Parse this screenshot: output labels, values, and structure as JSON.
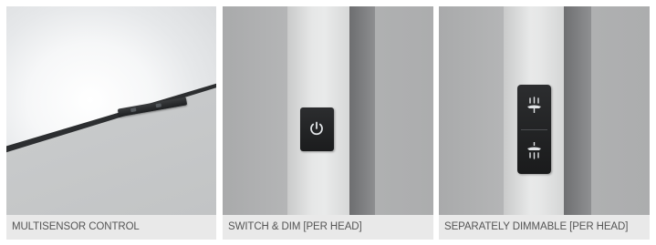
{
  "panels": [
    {
      "caption": "MULTISENSOR CONTROL"
    },
    {
      "caption": "SWITCH & DIM [PER HEAD]"
    },
    {
      "caption": "SEPARATELY DIMMABLE [PER HEAD]"
    }
  ],
  "icons": {
    "panel_2": "power-icon",
    "panel_3_top": "uplight-icon",
    "panel_3_bottom": "downlight-icon"
  },
  "colors": {
    "caption_bar": "#e9e9e9",
    "caption_text": "#555555",
    "control_plate": "#1f2021",
    "icon_symbol": "#e0e3e6"
  }
}
